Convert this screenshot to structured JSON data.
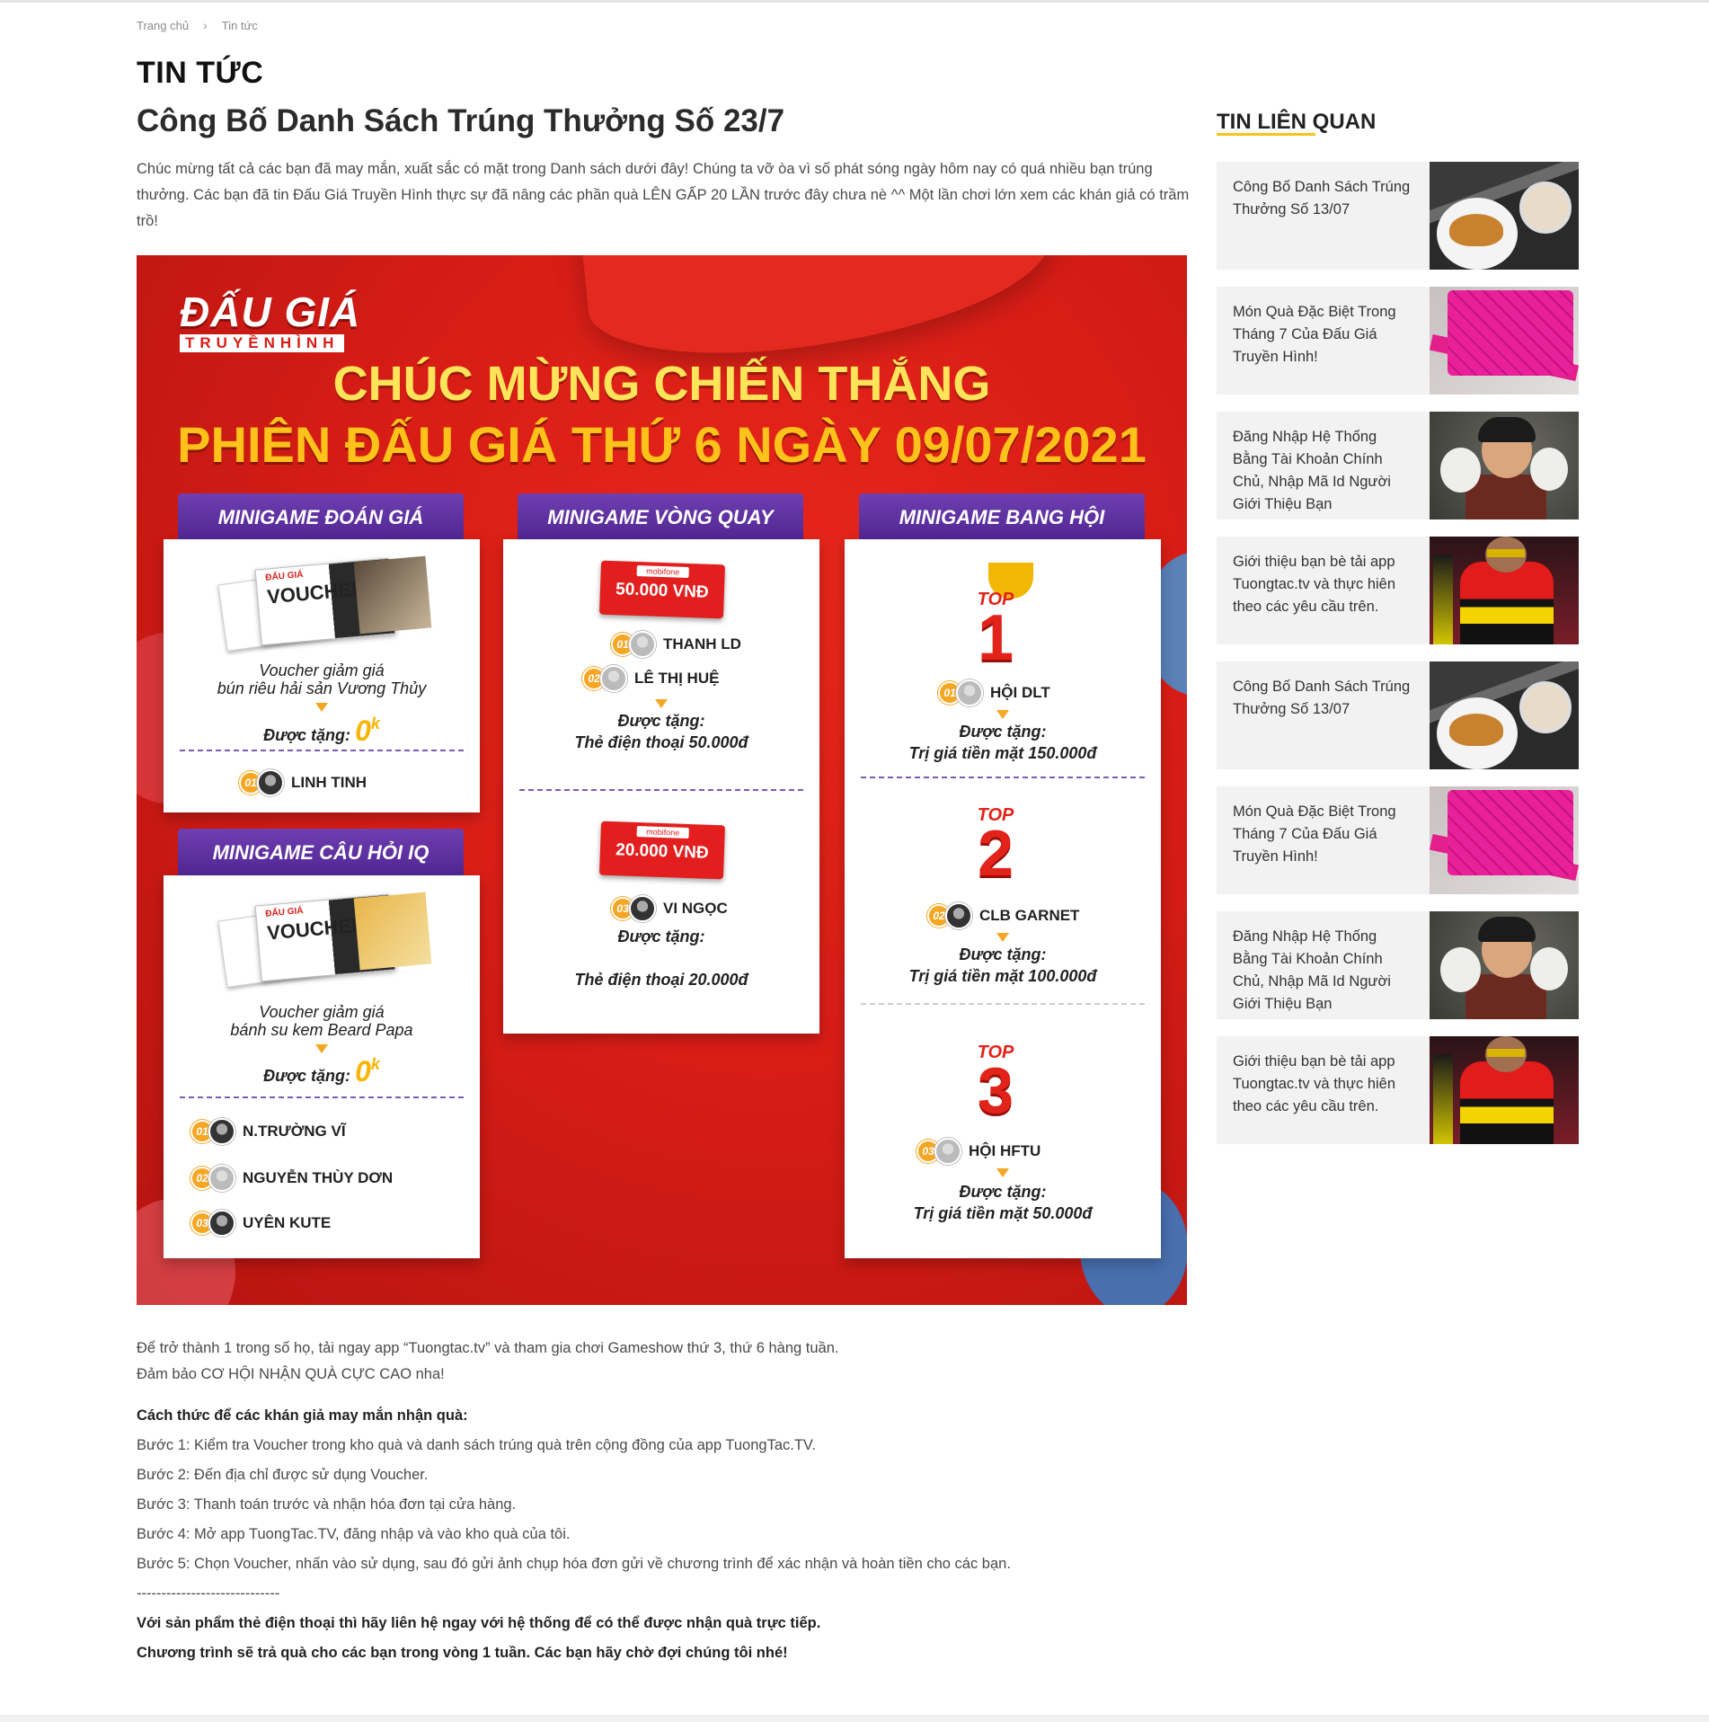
{
  "breadcrumb": {
    "home": "Trang chủ",
    "separator": "›",
    "current": "Tin tức"
  },
  "section_heading": "TIN TỨC",
  "article": {
    "title": "Công Bố Danh Sách Trúng Thưởng Số 23/7",
    "intro": "Chúc mừng tất cả các bạn đã may mắn, xuất sắc có mặt trong Danh sách dưới đây! Chúng ta vỡ òa vì số phát sóng ngày hôm nay có quá nhiều bạn trúng thưởng. Các bạn đã tin Đấu Giá Truyền Hình thực sự đã nâng các phần quà LÊN GẤP 20 LẦN trước đây chưa nè ^^ Một lần chơi lớn xem các khán giả có trầm trồ!",
    "cta_line1": "Để trở thành 1 trong số họ, tải ngay app “Tuongtac.tv” và tham gia chơi Gameshow thứ 3, thứ 6 hàng tuần.",
    "cta_line2": "Đảm bảo CƠ HỘI NHẬN QUÀ CỰC CAO nha!",
    "howto_heading": "Cách thức để các khán giả may mắn nhận quà:",
    "steps": [
      "Bước 1: Kiểm tra Voucher trong kho quà và danh sách trúng quà trên cộng đồng của app TuongTac.TV.",
      "Bước 2: Đến địa chỉ được sử dụng Voucher.",
      "Bước 3: Thanh toán trước và nhận hóa đơn tại cửa hàng.",
      "Bước 4: Mở app TuongTac.TV, đăng nhập và vào kho quà của tôi.",
      "Bước 5: Chọn Voucher, nhấn vào sử dụng, sau đó gửi ảnh chụp hóa đơn gửi về chương trình để xác nhận và hoàn tiền cho các bạn."
    ],
    "divider": "-----------------------------",
    "closing1": "Với sản phẩm thẻ điện thoại thì hãy liên hệ ngay với hệ thống để có thể được nhận quà trực tiếp.",
    "closing2": "Chương trình sẽ trả quà cho các bạn trong vòng 1 tuần. Các bạn hãy chờ đợi chúng tôi nhé!"
  },
  "poster": {
    "logo_big": "ĐẤU GIÁ",
    "logo_small": "TRUYỀNHÌNH",
    "congrats": "CHÚC MỪNG CHIẾN THẮNG",
    "session": "PHIÊN ĐẤU GIÁ THỨ 6 NGÀY 09/07/2021",
    "colors": {
      "background": "#d81d16",
      "tab": "#5a2d9c",
      "gold": "#ffc21a"
    },
    "guess": {
      "title": "MINIGAME ĐOÁN GIÁ",
      "voucher_word": "VOUCHER",
      "voucher_line1": "Voucher giảm giá",
      "voucher_line2": "bún riêu hải sản Vương Thủy",
      "prize_label": "Được tặng:",
      "prize_value": "0",
      "prize_suffix": "k",
      "winners": [
        {
          "rank": "01",
          "name": "LINH TINH"
        }
      ]
    },
    "iq": {
      "title": "MINIGAME CÂU HỎI IQ",
      "voucher_word": "VOUCHER",
      "voucher_line1": "Voucher giảm giá",
      "voucher_line2": "bánh su kem Beard Papa",
      "prize_label": "Được tặng:",
      "prize_value": "0",
      "prize_suffix": "k",
      "winners": [
        {
          "rank": "01",
          "name": "N.TRƯỜNG VĨ"
        },
        {
          "rank": "02",
          "name": "NGUYỄN THÙY DƠN"
        },
        {
          "rank": "03",
          "name": "UYÊN KUTE"
        }
      ]
    },
    "wheel": {
      "title": "MINIGAME VÒNG QUAY",
      "brand": "mobifone",
      "card1": "50.000 VNĐ",
      "winners1": [
        {
          "rank": "01",
          "name": "THANH LD"
        },
        {
          "rank": "02",
          "name": "LÊ THỊ HUỆ"
        }
      ],
      "prize_label": "Được tặng:",
      "prize1": "Thẻ điện thoại 50.000đ",
      "card2": "20.000 VNĐ",
      "winners2": [
        {
          "rank": "03",
          "name": "VI NGỌC"
        }
      ],
      "prize2": "Thẻ điện thoại 20.000đ"
    },
    "guild": {
      "title": "MINIGAME BANG HỘI",
      "top_word": "TOP",
      "prize_label": "Được tặng:",
      "tops": [
        {
          "num": "1",
          "rank": "01",
          "name": "HỘI DLT",
          "prize": "Trị giá tiền mặt 150.000đ"
        },
        {
          "num": "2",
          "rank": "02",
          "name": "CLB GARNET",
          "prize": "Trị giá tiền mặt  100.000đ"
        },
        {
          "num": "3",
          "rank": "03",
          "name": "HỘI HFTU",
          "prize": "Trị giá tiền mặt 50.000đ"
        }
      ]
    }
  },
  "sidebar": {
    "title": "TIN LIÊN QUAN",
    "accent": "#f5c518",
    "items": [
      {
        "title": "Công Bố Danh Sách Trúng Thưởng Số 13/07",
        "thumb": "food-photo"
      },
      {
        "title": "Món Quà Đặc Biệt Trong Tháng 7 Của Đấu Giá Truyền Hình!",
        "thumb": "handbag-photo"
      },
      {
        "title": "Đăng Nhập Hệ Thống Bằng Tài Khoản Chính Chủ, Nhập Mã Id Người Giới Thiệu Bạn",
        "thumb": "child-photo"
      },
      {
        "title": "Giới thiệu bạn bè tải app Tuongtac.tv và thực hiên theo các yêu cầu trên.",
        "thumb": "fashion-photo"
      },
      {
        "title": "Công Bố Danh Sách Trúng Thưởng Số 13/07",
        "thumb": "food-photo"
      },
      {
        "title": "Món Quà Đặc Biệt Trong Tháng 7 Của Đấu Giá Truyền Hình!",
        "thumb": "handbag-photo"
      },
      {
        "title": "Đăng Nhập Hệ Thống Bằng Tài Khoản Chính Chủ, Nhập Mã Id Người Giới Thiệu Bạn",
        "thumb": "child-photo"
      },
      {
        "title": "Giới thiệu bạn bè tải app Tuongtac.tv và thực hiên theo các yêu cầu trên.",
        "thumb": "fashion-photo"
      }
    ]
  }
}
